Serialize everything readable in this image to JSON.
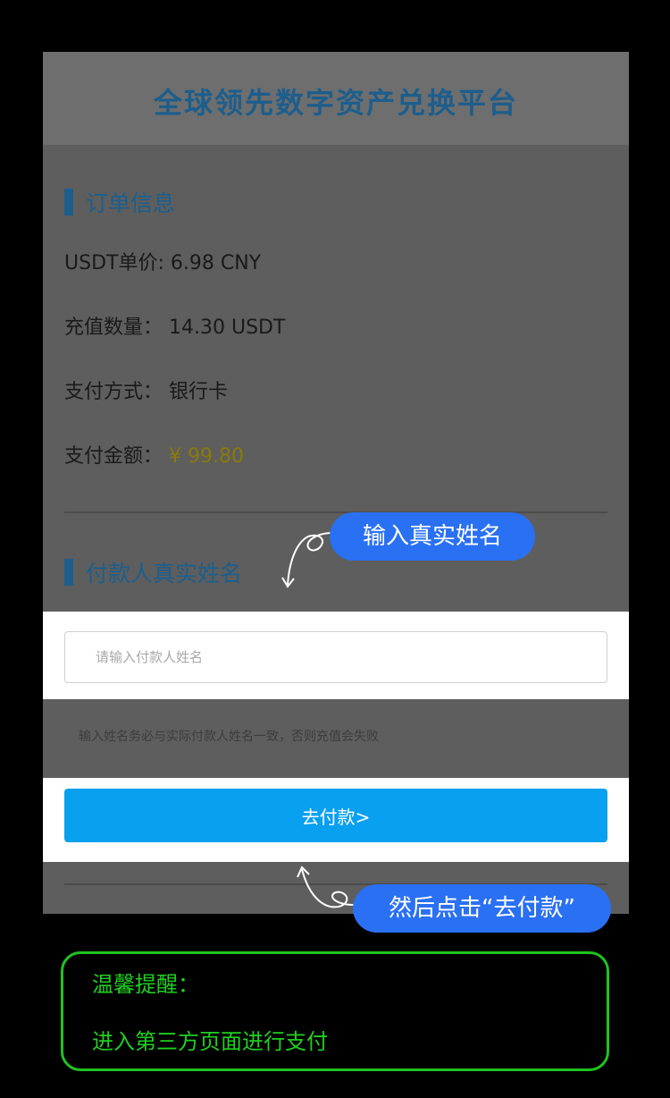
{
  "header": {
    "title": "全球领先数字资产兑换平台"
  },
  "order_info": {
    "section_title": "订单信息",
    "rows": [
      {
        "label": "USDT单价:",
        "value": "6.98 CNY"
      },
      {
        "label": "充值数量：",
        "value": "14.30 USDT"
      },
      {
        "label": "支付方式：",
        "value": "银行卡"
      },
      {
        "label": "支付金额：",
        "value": "¥ 99.80"
      }
    ]
  },
  "payer": {
    "section_title": "付款人真实姓名",
    "input_placeholder": "请输入付款人姓名",
    "hint": "输入姓名务必与实际付款人姓名一致，否则充值会失败"
  },
  "pay_button": {
    "label": "去付款>"
  },
  "annotations": {
    "bubble_name": "输入真实姓名",
    "bubble_pay": "然后点击“去付款”"
  },
  "tips": {
    "title": "温馨提醒：",
    "body": "进入第三方页面进行支付"
  },
  "colors": {
    "accent_blue": "#09a0f0",
    "bubble_blue": "#2a70f2",
    "tip_green": "#1fc31f"
  }
}
